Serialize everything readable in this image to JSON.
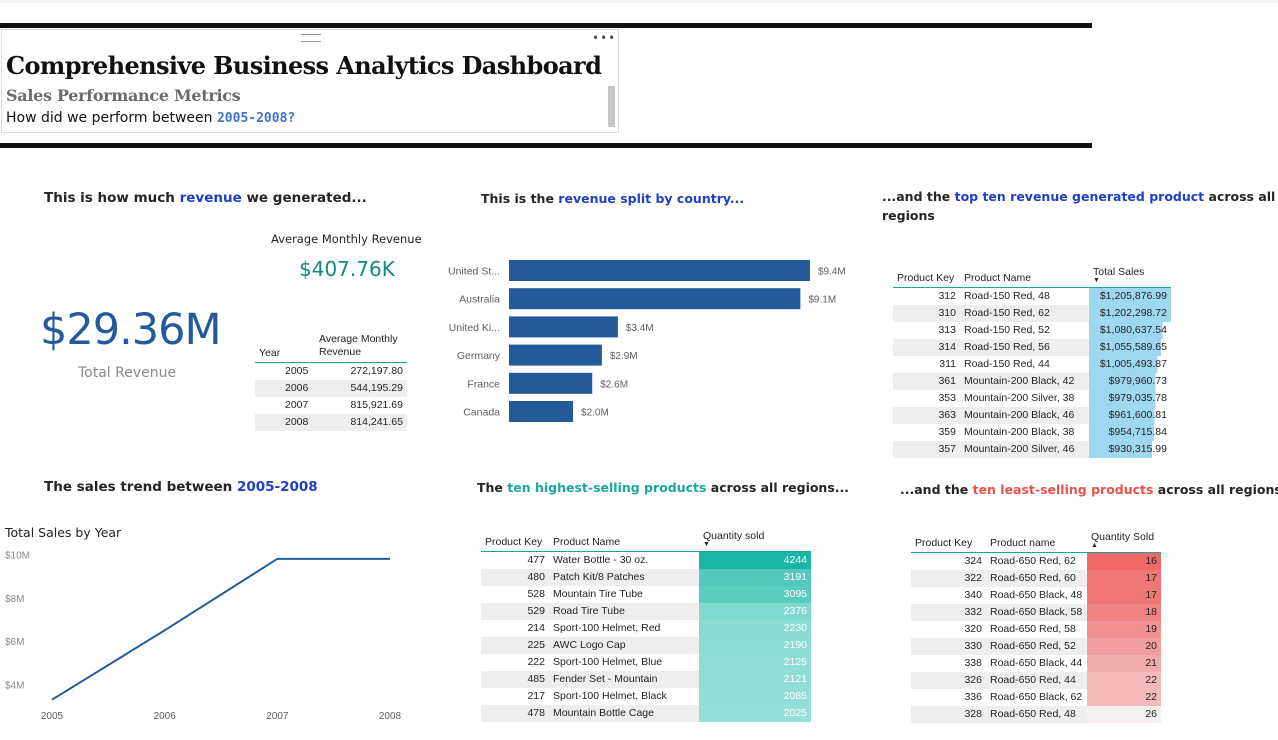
{
  "header": {
    "title": "Comprehensive Business Analytics Dashboard",
    "subtitle": "Sales Performance Metrics",
    "question_prefix": "How did we perform between ",
    "question_years": "2005-2008?"
  },
  "sections": {
    "revenue": {
      "pre": "This is how much ",
      "hl": "revenue",
      "post": " we generated..."
    },
    "country": {
      "pre": "This is the ",
      "hl": "revenue split by country...",
      "post": ""
    },
    "top_revenue": {
      "pre": "...and the ",
      "hl": "top ten revenue generated product",
      "post": " across all",
      "line2": "regions"
    },
    "trend": {
      "pre": "The sales trend between ",
      "hl": "2005-2008",
      "post": ""
    },
    "highest": {
      "pre": "The ",
      "hl": "ten highest-selling products",
      "post": " across all regions..."
    },
    "least": {
      "pre": "...and the ",
      "hl": "ten least-selling products",
      "post": " across all regions"
    }
  },
  "kpi": {
    "total_value": "$29.36M",
    "total_label": "Total Revenue",
    "avg_label": "Average Monthly Revenue",
    "avg_value": "$407.76K"
  },
  "yearly_table": {
    "headers": [
      "Year",
      "Average Monthly Revenue"
    ],
    "rows": [
      [
        "2005",
        "272,197.80"
      ],
      [
        "2006",
        "544,195.29"
      ],
      [
        "2007",
        "815,921.69"
      ],
      [
        "2008",
        "814,241.65"
      ]
    ]
  },
  "chart_data": [
    {
      "type": "bar",
      "orientation": "horizontal",
      "categories": [
        "United St...",
        "Australia",
        "United Ki...",
        "Germany",
        "France",
        "Canada"
      ],
      "values": [
        9.4,
        9.1,
        3.4,
        2.9,
        2.6,
        2.0
      ],
      "data_labels": [
        "$9.4M",
        "$9.1M",
        "$3.4M",
        "$2.9M",
        "$2.6M",
        "$2.0M"
      ],
      "xlim": [
        0,
        10.4
      ],
      "color": "#245a9a"
    },
    {
      "type": "line",
      "title": "Total Sales by Year",
      "x": [
        "2005",
        "2006",
        "2007",
        "2008"
      ],
      "values": [
        3.3,
        6.5,
        9.8,
        9.8
      ],
      "yticks": [
        "$10M",
        "$8M",
        "$6M",
        "$4M"
      ],
      "ytick_values": [
        10,
        8,
        6,
        4
      ],
      "color": "#245a9a"
    }
  ],
  "top_revenue_table": {
    "headers": [
      "Product Key",
      "Product Name",
      "Total Sales"
    ],
    "rows": [
      [
        "312",
        "Road-150 Red, 48",
        "$1,205,876.99",
        1205876.99
      ],
      [
        "310",
        "Road-150 Red, 62",
        "$1,202,298.72",
        1202298.72
      ],
      [
        "313",
        "Road-150 Red, 52",
        "$1,080,637.54",
        1080637.54
      ],
      [
        "314",
        "Road-150 Red, 56",
        "$1,055,589.65",
        1055589.65
      ],
      [
        "311",
        "Road-150 Red, 44",
        "$1,005,493.87",
        1005493.87
      ],
      [
        "361",
        "Mountain-200 Black, 42",
        "$979,960.73",
        979960.73
      ],
      [
        "353",
        "Mountain-200 Silver, 38",
        "$979,035.78",
        979035.78
      ],
      [
        "363",
        "Mountain-200 Black, 46",
        "$961,600.81",
        961600.81
      ],
      [
        "359",
        "Mountain-200 Black, 38",
        "$954,715.84",
        954715.84
      ],
      [
        "357",
        "Mountain-200 Silver, 46",
        "$930,315.99",
        930315.99
      ]
    ]
  },
  "highest_table": {
    "headers": [
      "Product Key",
      "Product Name",
      "Quantity sold"
    ],
    "rows": [
      [
        "477",
        "Water Bottle - 30 oz.",
        "4244",
        4244
      ],
      [
        "480",
        "Patch Kit/8 Patches",
        "3191",
        3191
      ],
      [
        "528",
        "Mountain Tire Tube",
        "3095",
        3095
      ],
      [
        "529",
        "Road Tire Tube",
        "2376",
        2376
      ],
      [
        "214",
        "Sport-100 Helmet, Red",
        "2230",
        2230
      ],
      [
        "225",
        "AWC Logo Cap",
        "2190",
        2190
      ],
      [
        "222",
        "Sport-100 Helmet, Blue",
        "2125",
        2125
      ],
      [
        "485",
        "Fender Set - Mountain",
        "2121",
        2121
      ],
      [
        "217",
        "Sport-100 Helmet, Black",
        "2085",
        2085
      ],
      [
        "478",
        "Mountain Bottle Cage",
        "2025",
        2025
      ]
    ]
  },
  "least_table": {
    "headers": [
      "Product Key",
      "Product name",
      "Quantity Sold"
    ],
    "rows": [
      [
        "324",
        "Road-650 Red, 62",
        "16",
        16
      ],
      [
        "322",
        "Road-650 Red, 60",
        "17",
        17
      ],
      [
        "340",
        "Road-650 Black, 48",
        "17",
        17
      ],
      [
        "332",
        "Road-650 Black, 58",
        "18",
        18
      ],
      [
        "320",
        "Road-650 Red, 58",
        "19",
        19
      ],
      [
        "330",
        "Road-650 Red, 52",
        "20",
        20
      ],
      [
        "338",
        "Road-650 Black, 44",
        "21",
        21
      ],
      [
        "326",
        "Road-650 Red, 44",
        "22",
        22
      ],
      [
        "336",
        "Road-650 Black, 62",
        "22",
        22
      ],
      [
        "328",
        "Road-650 Red, 48",
        "26",
        26
      ]
    ]
  },
  "colors": {
    "bar_blue": "#245a9a",
    "title_highlight": "#1f3fc4",
    "teal": "#1aa999",
    "red": "#e8524f",
    "kpi_teal": "#138a7e",
    "databar_light_blue": "#9fd6f0"
  },
  "icons": {
    "grip": "drag-handle-icon",
    "more": "more-options-icon",
    "sort": "sort-descending-icon"
  }
}
